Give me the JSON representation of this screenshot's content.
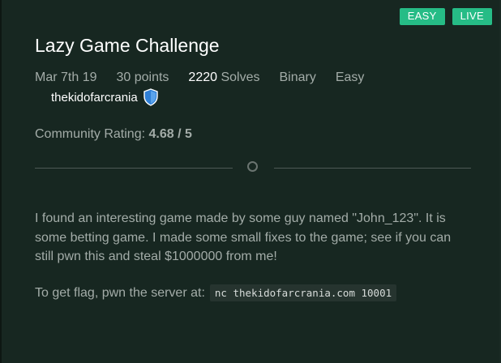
{
  "badges": [
    "EASY",
    "LIVE"
  ],
  "challenge": {
    "title": "Lazy Game Challenge",
    "date": "Mar 7th 19",
    "points": "30 points",
    "solves_count": "2220",
    "solves_label": "Solves",
    "category": "Binary",
    "difficulty": "Easy",
    "author": "thekidofarcrania",
    "author_icon": "shield-icon"
  },
  "rating": {
    "label": "Community Rating:",
    "value": "4.68 / 5"
  },
  "description": {
    "paragraph": "I found an interesting game made by some guy named \"John_123\". It is some betting game. I made some small fixes to the game; see if you can still pwn this and steal $1000000 from me!",
    "flag_text": "To get flag, pwn the server at:",
    "command": "nc thekidofarcrania.com 10001"
  },
  "colors": {
    "badge": "#26bc86",
    "background": "#172721",
    "shield": "#2f7fd6"
  }
}
